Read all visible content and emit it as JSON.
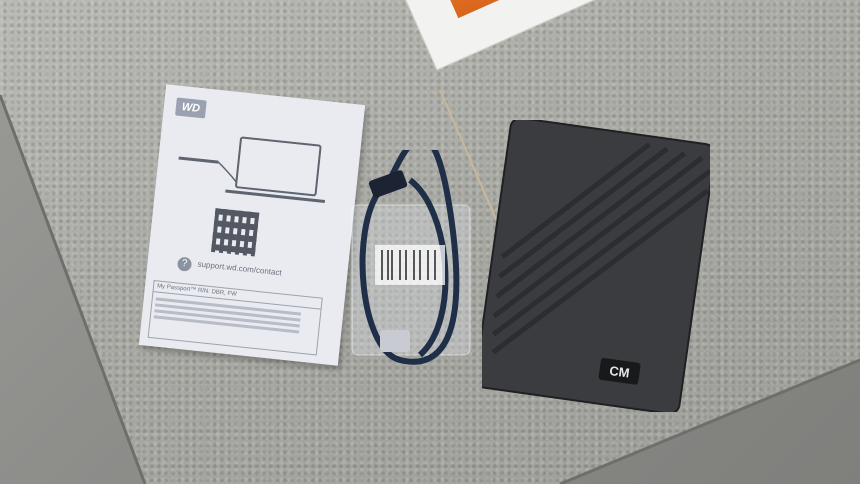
{
  "scene": {
    "objects": [
      {
        "name": "retail-box"
      },
      {
        "name": "quick-start-manual"
      },
      {
        "name": "usb-cable"
      },
      {
        "name": "portable-hard-drive"
      }
    ]
  },
  "manual": {
    "logo": "WD",
    "url": "support.wd.com/contact",
    "spec_title": "My Passport™ R/N: DBR, FW"
  },
  "drive": {
    "badge": "CM",
    "color": "#3b3c3f"
  },
  "colors": {
    "counter": "#a9a9a4",
    "box_accent": "#e97a2a",
    "manual_paper": "#e9ebf0",
    "cable": "#1f2f48"
  }
}
